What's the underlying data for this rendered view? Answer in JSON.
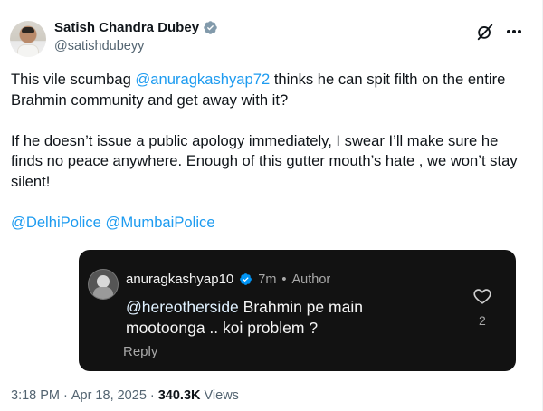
{
  "author": {
    "display_name": "Satish Chandra Dubey",
    "handle": "@satishdubeyy",
    "verified_color": "#829aab"
  },
  "tweet": {
    "p1_pre": "This vile scumbag ",
    "p1_mention": "@anuragkashyap72",
    "p1_post": " thinks he can spit filth on the entire Brahmin community and get away with it?",
    "p2": "If he doesn’t issue a public apology immediately, I swear I’ll make sure he finds no peace anywhere. Enough of this gutter mouth’s hate , we won’t stay silent!",
    "mention_1": "@DelhiPolice",
    "mention_2": "@MumbaiPolice"
  },
  "reply_card": {
    "username": "anuragkashyap10",
    "verified_color": "#0095f6",
    "time": "7m",
    "separator": "•",
    "role": "Author",
    "text_mention": "@hereotherside",
    "text_body": " Brahmin pe main mootoonga .. koi problem ?",
    "reply_label": "Reply",
    "like_count": "2"
  },
  "footer": {
    "time": "3:18 PM",
    "dot": "·",
    "date": "Apr 18, 2025",
    "dot2": "·",
    "views_count": "340.3K",
    "views_label": "Views"
  },
  "colors": {
    "accent": "#1d9bf0",
    "text": "#0f1419",
    "secondary": "#536471",
    "card_bg": "#121212"
  },
  "icons": [
    "verified-badge-icon",
    "grok-icon",
    "more-icon",
    "heart-icon"
  ]
}
